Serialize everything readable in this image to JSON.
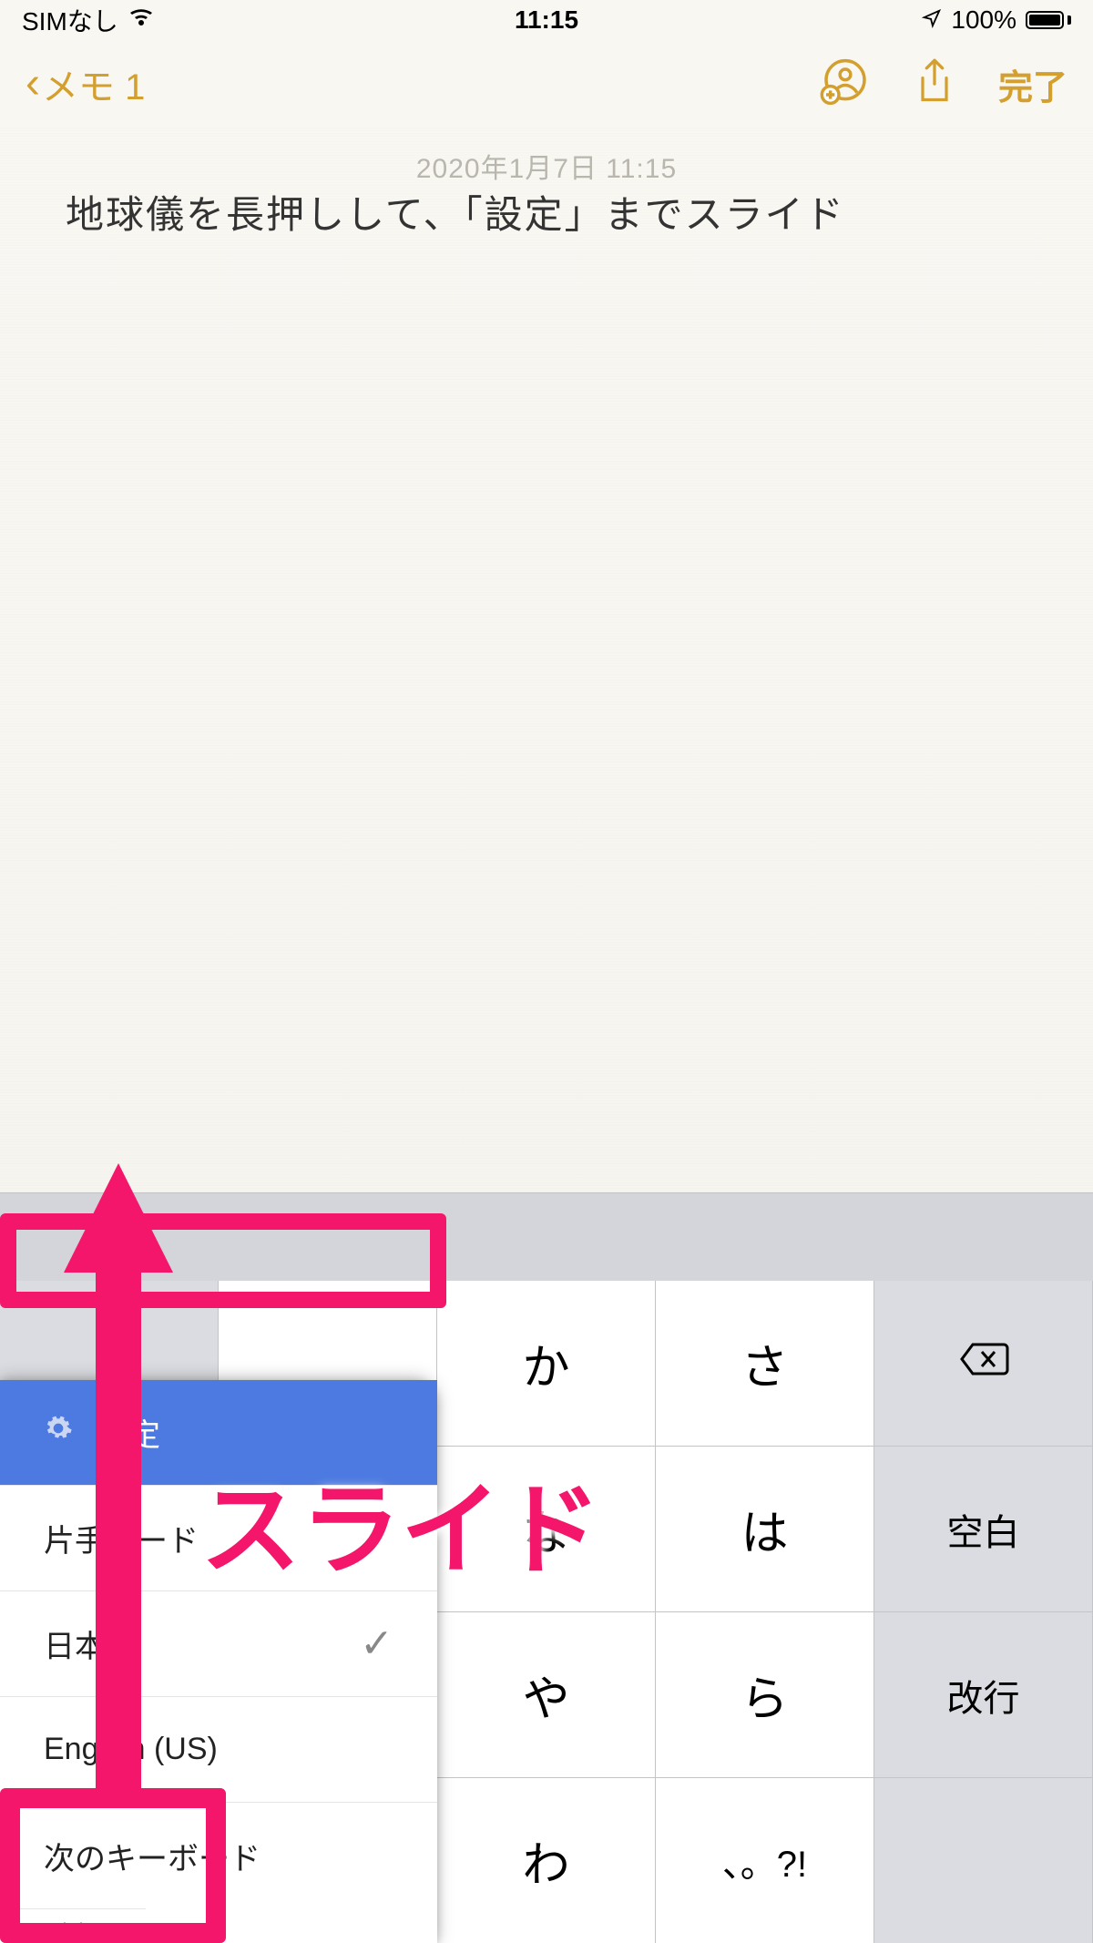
{
  "status": {
    "carrier": "SIMなし",
    "time": "11:15",
    "battery": "100%"
  },
  "nav": {
    "back_label": "メモ 1",
    "done_label": "完了"
  },
  "note": {
    "ghost_date": "2020年1月7日 11:15",
    "body": "地球儀を長押しして、「設定」までスライド"
  },
  "keyboard": {
    "popup": {
      "settings": "設定",
      "onehand": "片手モード",
      "japanese": "日本語",
      "english": "English (US)",
      "next": "次のキーボード"
    },
    "rows": {
      "r1": {
        "k2": "か",
        "k3": "さ"
      },
      "r2": {
        "k2": "な",
        "k3": "は",
        "space": "空白"
      },
      "r3": {
        "k2": "や",
        "k3": "ら",
        "return": "改行"
      },
      "r4": {
        "k2": "わ",
        "k3": "、。?!"
      }
    }
  },
  "annotation": {
    "slide_label": "スライド"
  }
}
